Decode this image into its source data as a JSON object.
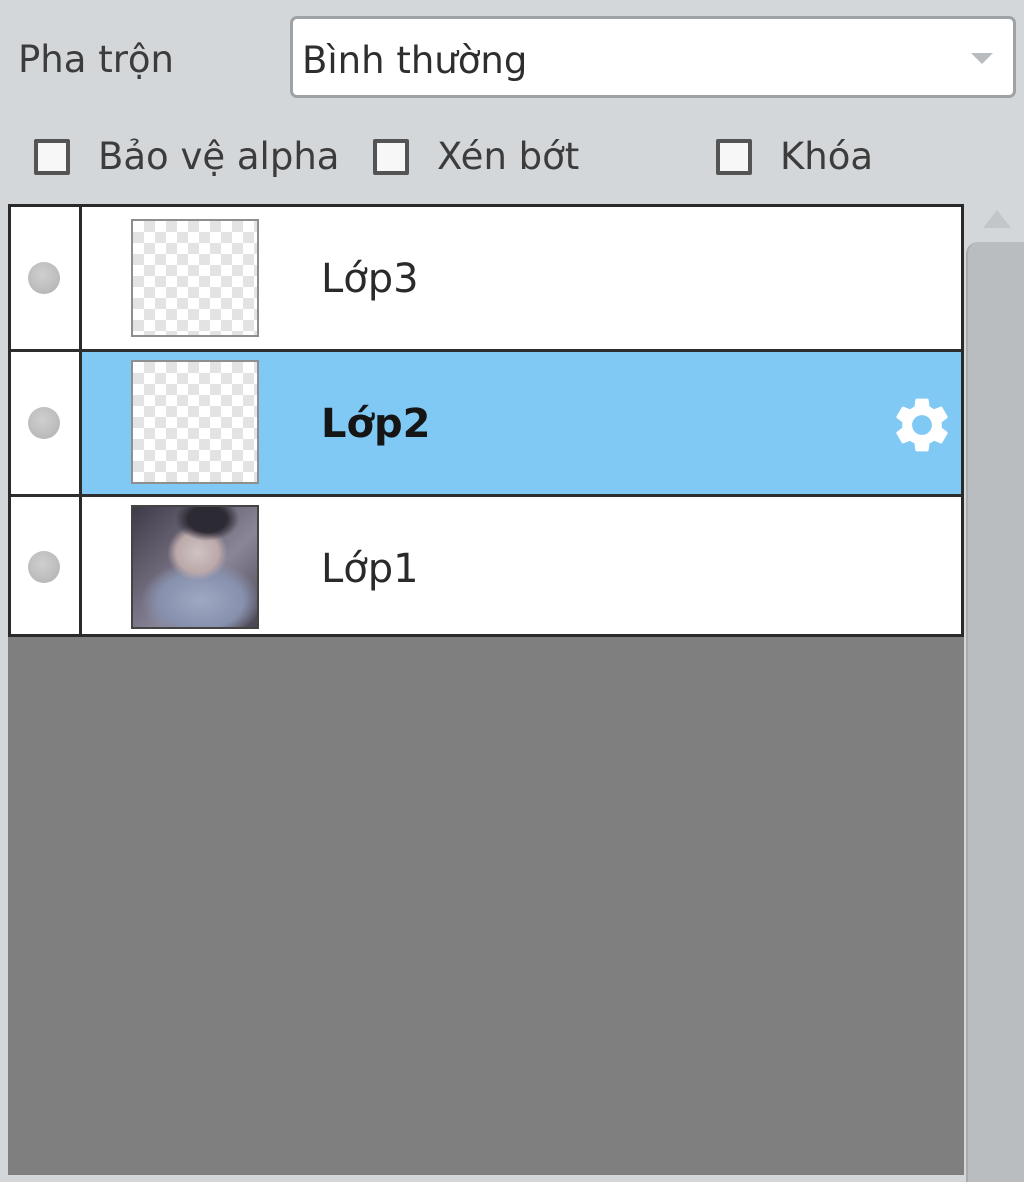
{
  "blend": {
    "label": "Pha trộn",
    "selected": "Bình thường"
  },
  "options": {
    "protect_alpha": {
      "label": "Bảo vệ alpha",
      "checked": false
    },
    "clipping": {
      "label": "Xén bớt",
      "checked": false
    },
    "lock": {
      "label": "Khóa",
      "checked": false
    }
  },
  "layers": [
    {
      "name": "Lớp3",
      "selected": false,
      "thumbnail": "transparent"
    },
    {
      "name": "Lớp2",
      "selected": true,
      "thumbnail": "transparent"
    },
    {
      "name": "Lớp1",
      "selected": false,
      "thumbnail": "photo"
    }
  ],
  "colors": {
    "selected_row": "#80c9f4",
    "panel_background": "#7f7f7f",
    "window_background": "#d3d7da"
  },
  "icons": {
    "layer_settings": "gear-icon",
    "visibility": "visibility-dot-icon",
    "dropdown": "chevron-down-icon",
    "scroll_up": "scroll-up-arrow-icon"
  }
}
